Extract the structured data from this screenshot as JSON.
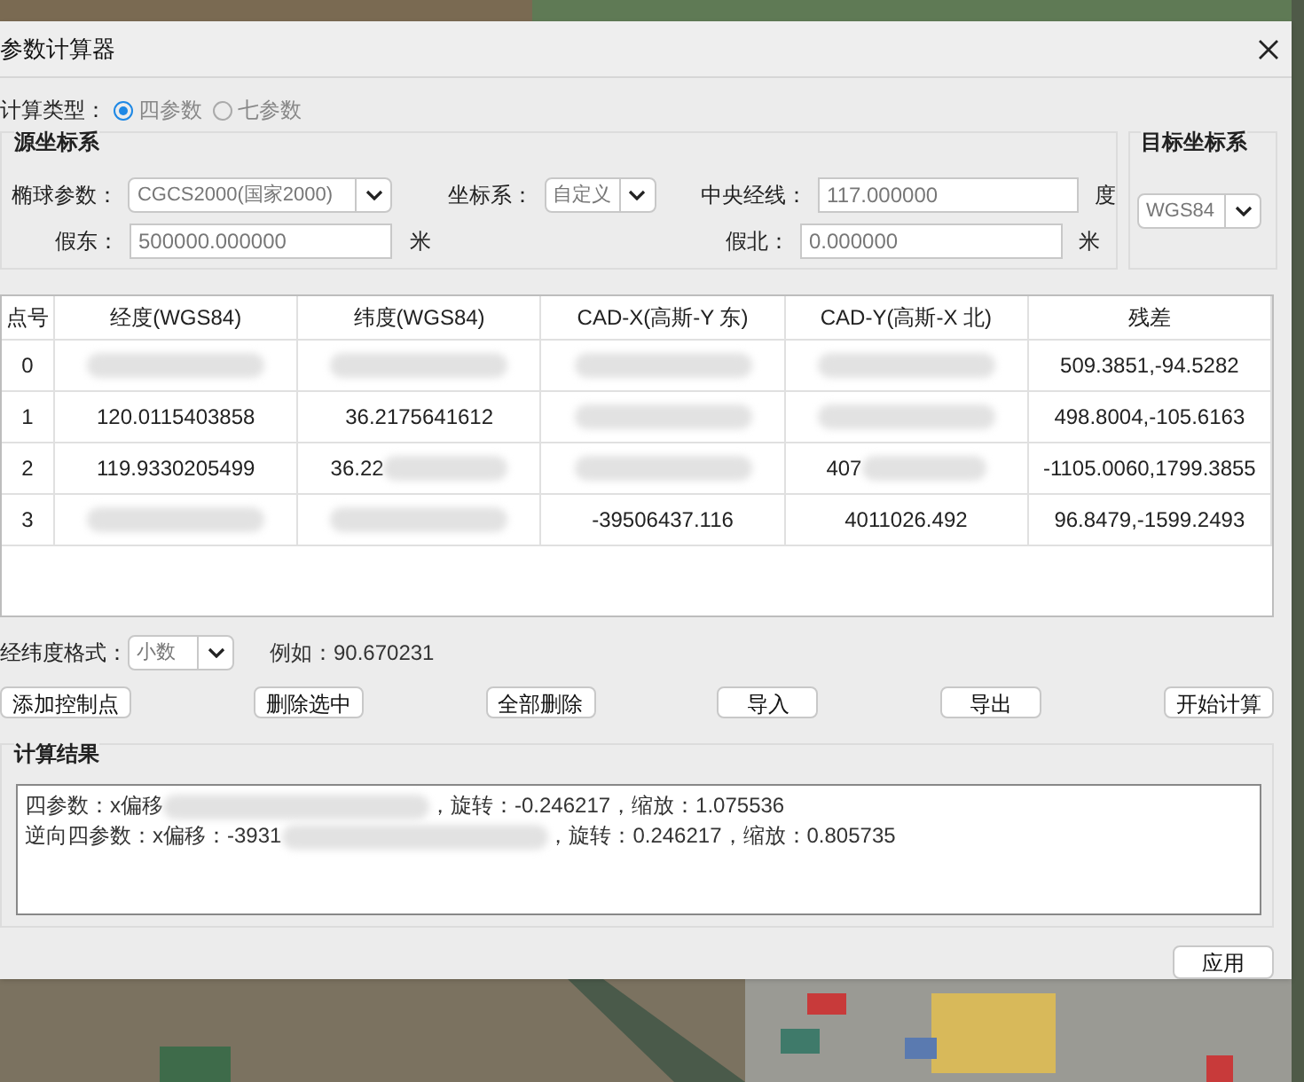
{
  "window": {
    "title": "参数计算器"
  },
  "calc_type": {
    "label": "计算类型：",
    "options": [
      {
        "label": "四参数",
        "selected": true
      },
      {
        "label": "七参数",
        "selected": false
      }
    ]
  },
  "source": {
    "title": "源坐标系",
    "fields": [
      {
        "label": "椭球参数：",
        "kind": "combo",
        "value": "CGCS2000(国家2000)"
      },
      {
        "label": "坐标系：",
        "kind": "combo",
        "value": "自定义"
      },
      {
        "label": "中央经线：",
        "kind": "input",
        "value": "117.000000",
        "unit": "度"
      },
      {
        "label": "假东：",
        "kind": "input",
        "value": "500000.000000",
        "unit": "米"
      },
      {
        "label": "假北：",
        "kind": "input",
        "value": "0.000000",
        "unit": "米"
      }
    ]
  },
  "target": {
    "title": "目标坐标系",
    "value": "WGS84"
  },
  "table": {
    "columns": [
      "点号",
      "经度(WGS84)",
      "纬度(WGS84)",
      "CAD-X(高斯-Y 东)",
      "CAD-Y(高斯-X 北)",
      "残差"
    ],
    "rows": [
      [
        {
          "text": "0"
        },
        {
          "redacted": true
        },
        {
          "redacted": true
        },
        {
          "redacted": true
        },
        {
          "redacted": true
        },
        {
          "text": "509.3851,-94.5282"
        }
      ],
      [
        {
          "text": "1"
        },
        {
          "text": "120.0115403858"
        },
        {
          "text": "36.2175641612"
        },
        {
          "redacted": true
        },
        {
          "redacted": true
        },
        {
          "text": "498.8004,-105.6163"
        }
      ],
      [
        {
          "text": "2"
        },
        {
          "text": "119.9330205499"
        },
        {
          "text": "36.22",
          "redacted": true
        },
        {
          "redacted": true
        },
        {
          "text": "407",
          "redacted": true
        },
        {
          "text": "-1105.0060,1799.3855"
        }
      ],
      [
        {
          "text": "3"
        },
        {
          "redacted": true
        },
        {
          "redacted": true
        },
        {
          "text": "-39506437.116"
        },
        {
          "text": "4011026.492"
        },
        {
          "text": "96.8479,-1599.2493"
        }
      ]
    ]
  },
  "format": {
    "label": "经纬度格式：",
    "value": "小数",
    "example": "例如：90.670231"
  },
  "buttons": [
    "添加控制点",
    "删除选中",
    "全部删除",
    "导入",
    "导出",
    "开始计算"
  ],
  "result": {
    "title": "计算结果",
    "lines": [
      [
        {
          "text": "四参数：x偏移"
        },
        {
          "redacted": true
        },
        {
          "text": "，旋转：-0.246217，缩放：1.075536"
        }
      ],
      [
        {
          "text": "逆向四参数：x偏移：-3931"
        },
        {
          "redacted": true
        },
        {
          "text": "，旋转：0.246217，缩放：0.805735"
        }
      ]
    ]
  },
  "apply_button": "应用"
}
